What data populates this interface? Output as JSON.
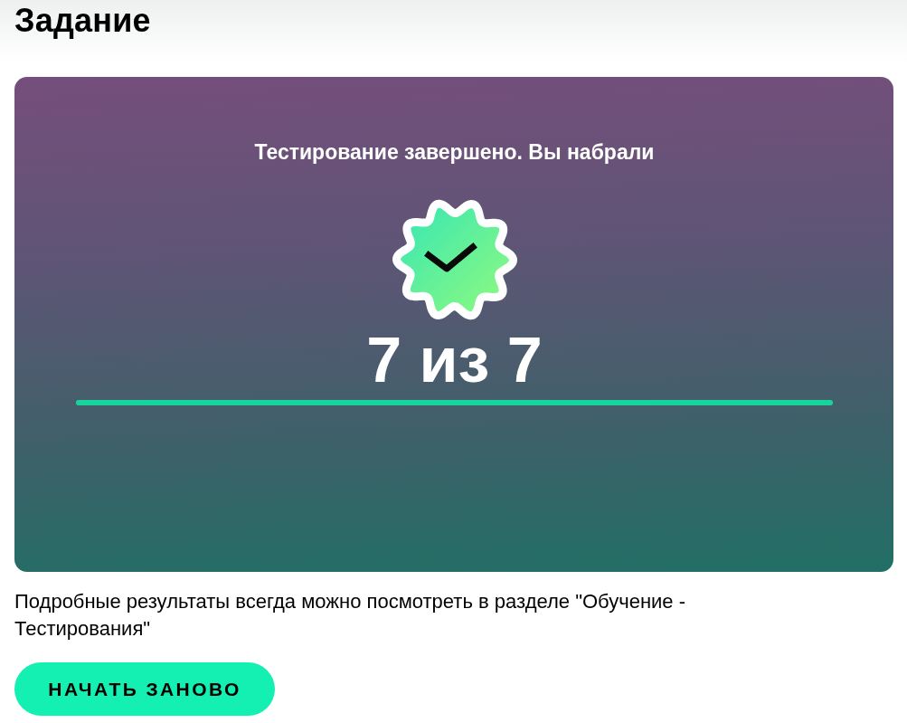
{
  "title": "Задание",
  "result": {
    "heading": "Тестирование завершено. Вы набрали",
    "passed": true,
    "score": "7 из 7",
    "progress": {
      "level": 1
    }
  },
  "note": "Подробные результаты всегда можно посмотреть в разделе \"Обучение - Тестирования\"",
  "buttons": [
    {
      "label": "НАЧАТЬ ЗАНОВО",
      "kind": "primary"
    }
  ]
}
